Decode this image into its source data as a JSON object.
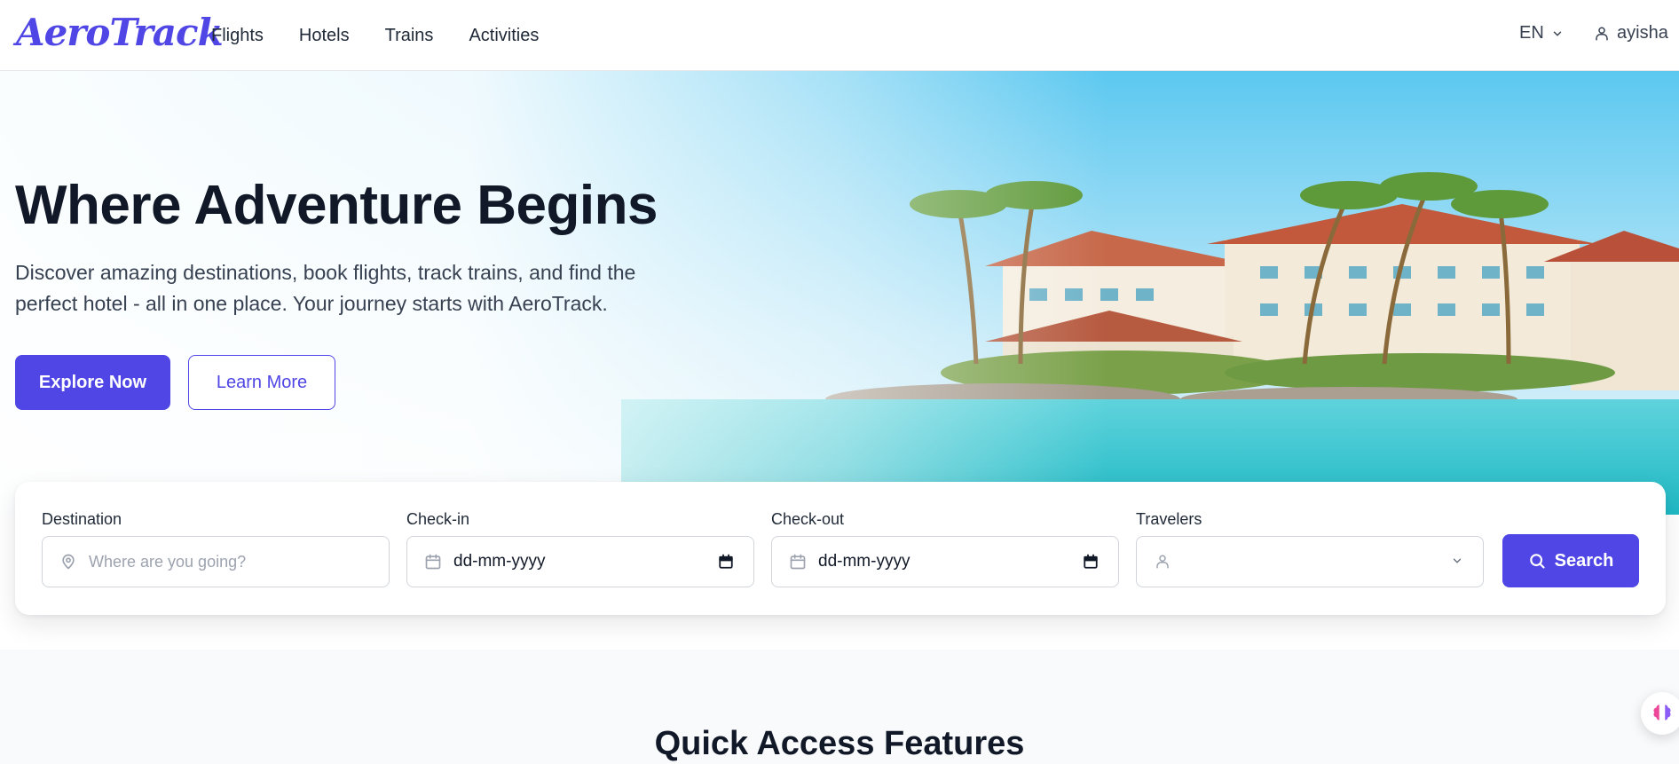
{
  "brand": {
    "logo_text": "AeroTrack",
    "accent": "#4f46e5"
  },
  "nav": {
    "links": [
      "Flights",
      "Hotels",
      "Trains",
      "Activities"
    ],
    "language": "EN",
    "username": "ayisha"
  },
  "hero": {
    "title": "Where Adventure Begins",
    "subtitle": "Discover amazing destinations, book flights, track trains, and find the perfect hotel - all in one place. Your journey starts with AeroTrack.",
    "primary_button": "Explore Now",
    "secondary_button": "Learn More"
  },
  "search": {
    "destination": {
      "label": "Destination",
      "placeholder": "Where are you going?",
      "icon": "map-pin-icon"
    },
    "checkin": {
      "label": "Check-in",
      "value": "dd-mm-yyyy",
      "icon": "calendar-icon"
    },
    "checkout": {
      "label": "Check-out",
      "value": "dd-mm-yyyy",
      "icon": "calendar-icon"
    },
    "travelers": {
      "label": "Travelers",
      "value": "",
      "icon": "user-icon"
    },
    "button": "Search"
  },
  "features": {
    "title": "Quick Access Features"
  },
  "ai_assistant": {
    "icon": "brain-icon"
  }
}
